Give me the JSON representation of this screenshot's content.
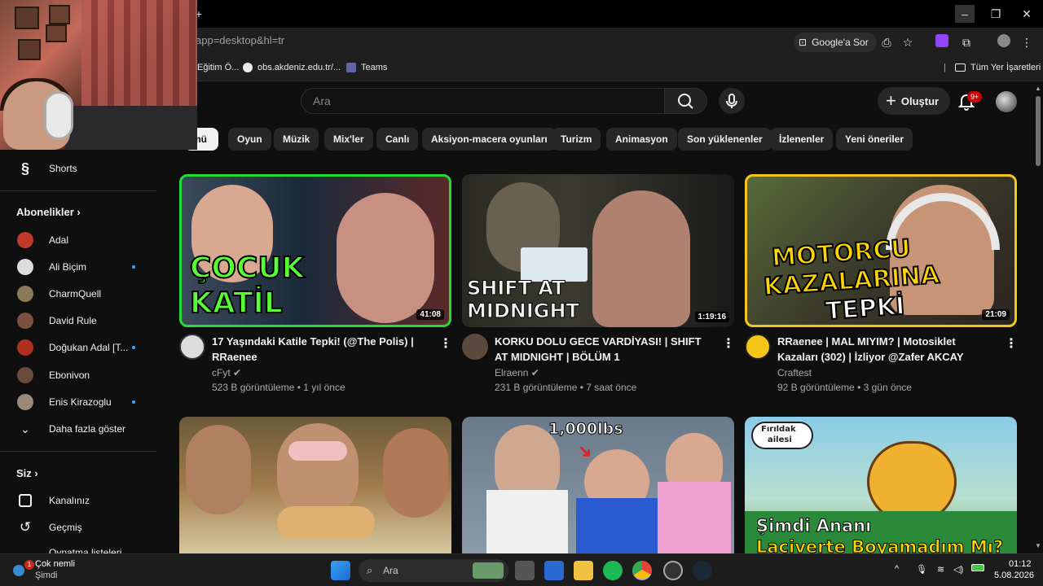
{
  "browser": {
    "new_tab_symbol": "+",
    "url": "app=desktop&hl=tr",
    "google_ask": "Google'a Sor",
    "bookmarks": [
      {
        "label": "Eğitim Ö..."
      },
      {
        "label": "obs.akdeniz.edu.tr/..."
      },
      {
        "label": "Teams"
      }
    ],
    "all_bookmarks": "Tüm Yer İşaretleri"
  },
  "youtube": {
    "search_placeholder": "Ara",
    "create_label": "Oluştur",
    "notification_count": "9+",
    "chips": [
      "Tümü",
      "Oyun",
      "Müzik",
      "Mix'ler",
      "Canlı",
      "Aksiyon-macera oyunları",
      "Turizm",
      "Animasyon",
      "Son yüklenenler",
      "İzlenenler",
      "Yeni öneriler"
    ],
    "chip_first_visible": "mü",
    "sidebar": {
      "shorts": "Shorts",
      "subscriptions_heading": "Abonelikler",
      "subscriptions": [
        {
          "name": "Adal",
          "new": false,
          "color": "#c0392b"
        },
        {
          "name": "Ali Biçim",
          "new": true,
          "color": "#dddddd"
        },
        {
          "name": "CharmQuell",
          "new": false,
          "color": "#8a7a5a"
        },
        {
          "name": "David Rule",
          "new": false,
          "color": "#7a5040"
        },
        {
          "name": "Doğukan Adal [T...",
          "new": true,
          "color": "#b03020"
        },
        {
          "name": "Ebonivon",
          "new": false,
          "color": "#6a4a3a"
        },
        {
          "name": "Enis Kirazoglu",
          "new": true,
          "color": "#9a8a7a"
        }
      ],
      "show_more": "Daha fazla göster",
      "you_heading": "Siz",
      "your_channel": "Kanalınız",
      "history": "Geçmiş",
      "partial_item": "Oynatma listeleri"
    },
    "videos": [
      {
        "title": "17 Yaşındaki Katile Tepki! (@The Polis) | RRaenee",
        "channel": "cFyt",
        "verified": true,
        "meta": "523 B görüntüleme • 1 yıl önce",
        "duration": "41:08",
        "thumb_text": [
          "ÇOCUK",
          "KATİL"
        ]
      },
      {
        "title": "KORKU DOLU GECE VARDİYASI! | SHIFT AT MIDNIGHT | BÖLÜM 1",
        "channel": "Elraenn",
        "verified": true,
        "meta": "231 B görüntüleme • 7 saat önce",
        "duration": "1:19:16",
        "thumb_text": [
          "SHIFT AT",
          "MIDNIGHT"
        ]
      },
      {
        "title": "RRaenee | MAL MIYIM? | Motosiklet Kazaları (302) | İzliyor @Zafer AKCAY",
        "channel": "Craftest",
        "verified": false,
        "meta": "92 B görüntüleme • 3 gün önce",
        "duration": "21:09",
        "thumb_text": [
          "MOTORCU",
          "KAZALARINA",
          "TEPKİ"
        ]
      },
      {
        "thumb_text": []
      },
      {
        "thumb_text": [
          "1,000lbs"
        ]
      },
      {
        "thumb_text": [
          "Fırıldak",
          "ailesi",
          "Şimdi Ananı",
          "Laciverte Boyamadım Mı?"
        ]
      }
    ]
  },
  "taskbar": {
    "notification_title": "Çok nemli",
    "notification_sub": "Şimdi",
    "notification_count": "1",
    "search": "Ara",
    "time": "01:12",
    "date": "5.08.2026"
  }
}
